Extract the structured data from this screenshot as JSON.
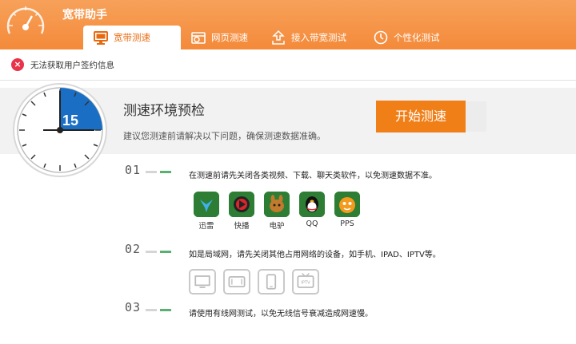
{
  "app": {
    "title": "宽带助手"
  },
  "tabs": [
    {
      "label": "宽带测速",
      "icon": "monitor-icon",
      "active": true
    },
    {
      "label": "网页测速",
      "icon": "browser-icon",
      "active": false
    },
    {
      "label": "接入带宽测试",
      "icon": "upload-icon",
      "active": false
    },
    {
      "label": "个性化测试",
      "icon": "clock-icon",
      "active": false
    }
  ],
  "alert": {
    "text": "无法获取用户签约信息",
    "icon": "close-circle-icon"
  },
  "pretest": {
    "title": "测速环境预检",
    "subtitle": "建议您测速前请解决以下问题，确保测速数据准确。",
    "start_button": "开始测速",
    "timer_value": "15"
  },
  "steps": [
    {
      "num": "01",
      "text": "在测速前请先关闭各类视频、下载、聊天类软件，以免测速数据不准。"
    },
    {
      "num": "02",
      "text": "如是局域网，请先关闭其他占用网络的设备，如手机、IPAD、IPTV等。"
    },
    {
      "num": "03",
      "text": "请使用有线网测试，以免无线信号衰减造成网速慢。"
    }
  ],
  "apps": [
    {
      "label": "迅雷",
      "icon": "xunlei-icon"
    },
    {
      "label": "快播",
      "icon": "kuaibo-icon"
    },
    {
      "label": "电驴",
      "icon": "edonkey-icon"
    },
    {
      "label": "QQ",
      "icon": "qq-icon"
    },
    {
      "label": "PPS",
      "icon": "pps-icon"
    }
  ],
  "devices": [
    {
      "icon": "monitor-device-icon"
    },
    {
      "icon": "tablet-device-icon"
    },
    {
      "icon": "phone-device-icon"
    },
    {
      "icon": "iptv-device-icon",
      "label": "IPTV"
    }
  ],
  "colors": {
    "accent": "#f48a3a",
    "button": "#f07f18",
    "timer": "#1a6fc4",
    "step_green": "#5ab06e",
    "alert_red": "#e8334a"
  }
}
